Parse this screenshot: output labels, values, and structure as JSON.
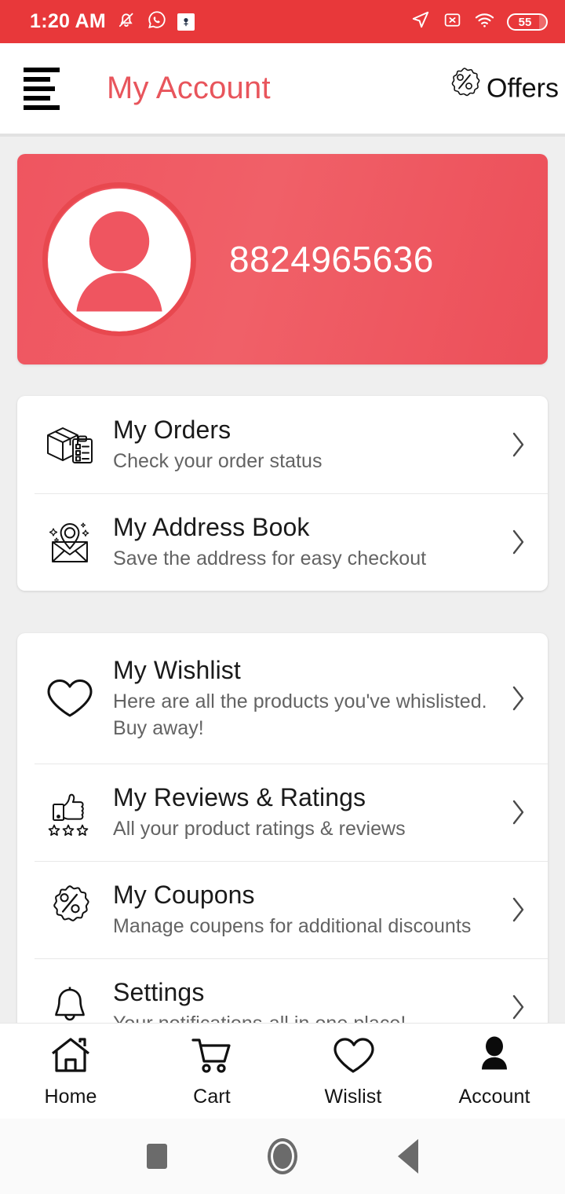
{
  "status_bar": {
    "time": "1:20 AM",
    "battery_level": "55",
    "left_icons": [
      "bell-muted-icon",
      "whatsapp-icon",
      "app-badge-icon"
    ],
    "right_icons": [
      "location-arrow-icon",
      "sim-disabled-icon",
      "wifi-icon",
      "battery-icon"
    ],
    "background_color": "#e8383a"
  },
  "header": {
    "menu_icon": "hamburger-menu-icon",
    "title": "My Account",
    "title_color": "#e8555c",
    "offers_icon": "discount-badge-icon",
    "offers_label": "Offers"
  },
  "profile": {
    "phone": "8824965636",
    "avatar_icon": "user-avatar-icon",
    "card_color": "#ef5560"
  },
  "sections": [
    {
      "rows": [
        {
          "icon": "package-order-icon",
          "title": "My Orders",
          "subtitle": "Check your order status",
          "chevron": "chevron-right-icon"
        },
        {
          "icon": "address-pin-envelope-icon",
          "title": "My Address Book",
          "subtitle": "Save the address for easy checkout",
          "chevron": "chevron-right-icon"
        }
      ]
    },
    {
      "rows": [
        {
          "icon": "heart-outline-icon",
          "title": "My Wishlist",
          "subtitle": "Here are all the products you've whislisted. Buy away!",
          "chevron": "chevron-right-icon"
        },
        {
          "icon": "thumbs-up-stars-icon",
          "title": "My Reviews & Ratings",
          "subtitle": "All your product ratings & reviews",
          "chevron": "chevron-right-icon"
        },
        {
          "icon": "discount-badge-icon",
          "title": "My Coupons",
          "subtitle": "Manage coupens for additional discounts",
          "chevron": "chevron-right-icon"
        },
        {
          "icon": "bell-icon",
          "title": "Settings",
          "subtitle": "Your notifications-all in one place!",
          "chevron": "chevron-right-icon"
        }
      ]
    }
  ],
  "bottom_nav": {
    "items": [
      {
        "icon": "home-icon",
        "label": "Home",
        "active": false
      },
      {
        "icon": "cart-icon",
        "label": "Cart",
        "active": false
      },
      {
        "icon": "heart-icon",
        "label": "Wislist",
        "active": false
      },
      {
        "icon": "account-icon",
        "label": "Account",
        "active": true
      }
    ]
  },
  "system_nav": {
    "recents": "recents-square-icon",
    "home": "home-circle-icon",
    "back": "back-triangle-icon"
  }
}
